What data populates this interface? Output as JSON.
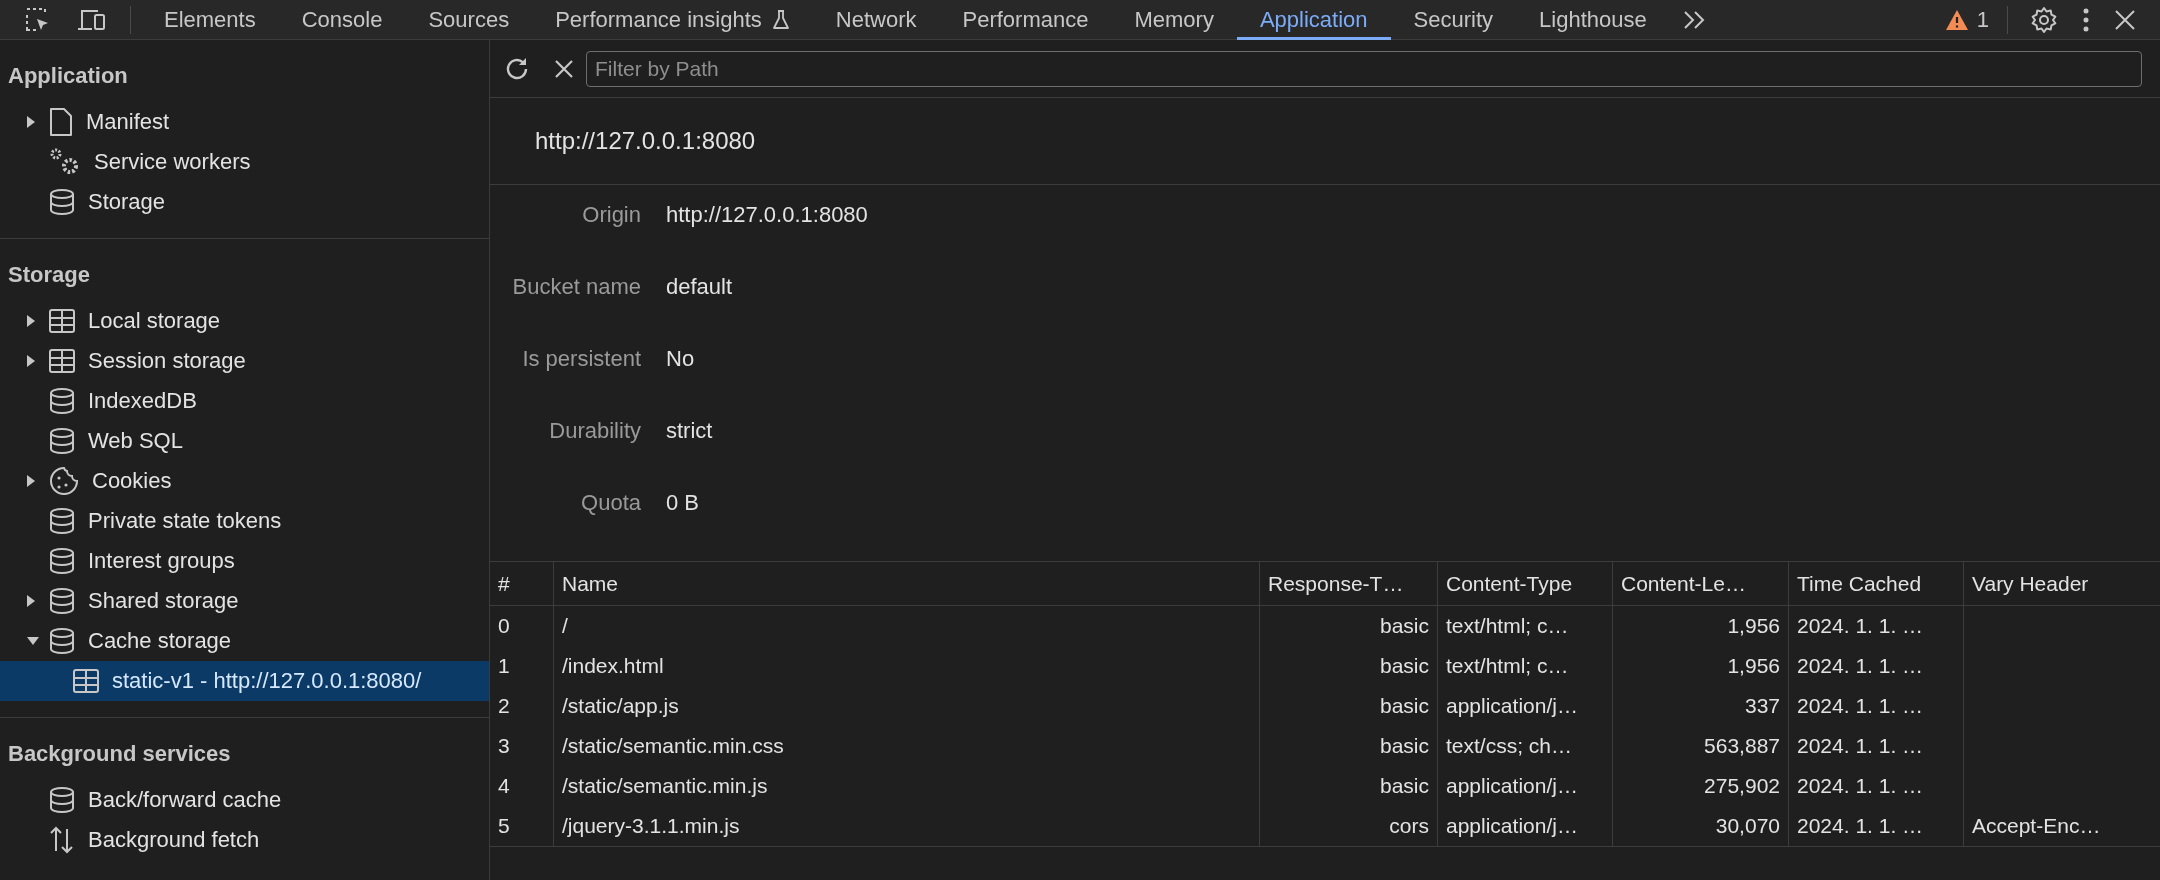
{
  "toolbar": {
    "tabs": [
      {
        "label": "Elements",
        "selected": false,
        "experimental": false
      },
      {
        "label": "Console",
        "selected": false,
        "experimental": false
      },
      {
        "label": "Sources",
        "selected": false,
        "experimental": false
      },
      {
        "label": "Performance insights",
        "selected": false,
        "experimental": true
      },
      {
        "label": "Network",
        "selected": false,
        "experimental": false
      },
      {
        "label": "Performance",
        "selected": false,
        "experimental": false
      },
      {
        "label": "Memory",
        "selected": false,
        "experimental": false
      },
      {
        "label": "Application",
        "selected": true,
        "experimental": false
      },
      {
        "label": "Security",
        "selected": false,
        "experimental": false
      },
      {
        "label": "Lighthouse",
        "selected": false,
        "experimental": false
      }
    ],
    "warning_count": "1"
  },
  "sidebar": {
    "sections": [
      {
        "title": "Application",
        "items": [
          {
            "label": "Manifest",
            "kind": "file",
            "expanded": false,
            "selected": false
          },
          {
            "label": "Service workers",
            "kind": "gears",
            "selected": false
          },
          {
            "label": "Storage",
            "kind": "database",
            "selected": false
          }
        ]
      },
      {
        "title": "Storage",
        "items": [
          {
            "label": "Local storage",
            "kind": "table",
            "expanded": false,
            "selected": false
          },
          {
            "label": "Session storage",
            "kind": "table",
            "expanded": false,
            "selected": false
          },
          {
            "label": "IndexedDB",
            "kind": "database",
            "selected": false
          },
          {
            "label": "Web SQL",
            "kind": "database",
            "selected": false
          },
          {
            "label": "Cookies",
            "kind": "cookie",
            "expanded": false,
            "selected": false
          },
          {
            "label": "Private state tokens",
            "kind": "database",
            "selected": false
          },
          {
            "label": "Interest groups",
            "kind": "database",
            "selected": false
          },
          {
            "label": "Shared storage",
            "kind": "database",
            "expanded": false,
            "selected": false
          },
          {
            "label": "Cache storage",
            "kind": "database",
            "expanded": true,
            "selected": false,
            "children": [
              {
                "label": "static-v1 - http://127.0.0.1:8080/",
                "kind": "table",
                "selected": true
              }
            ]
          }
        ]
      },
      {
        "title": "Background services",
        "items": [
          {
            "label": "Back/forward cache",
            "kind": "database",
            "selected": false
          },
          {
            "label": "Background fetch",
            "kind": "arrows",
            "selected": false
          }
        ]
      }
    ]
  },
  "filter": {
    "placeholder": "Filter by Path"
  },
  "origin_title": "http://127.0.0.1:8080",
  "details": [
    {
      "label": "Origin",
      "value": "http://127.0.0.1:8080"
    },
    {
      "label": "Bucket name",
      "value": "default"
    },
    {
      "label": "Is persistent",
      "value": "No"
    },
    {
      "label": "Durability",
      "value": "strict"
    },
    {
      "label": "Quota",
      "value": "0 B"
    }
  ],
  "table": {
    "columns": [
      {
        "label": "#",
        "kind": "text"
      },
      {
        "label": "Name",
        "kind": "text"
      },
      {
        "label": "Response-T…",
        "kind": "numeric"
      },
      {
        "label": "Content-Type",
        "kind": "text"
      },
      {
        "label": "Content-Le…",
        "kind": "numeric"
      },
      {
        "label": "Time Cached",
        "kind": "text"
      },
      {
        "label": "Vary Header",
        "kind": "text"
      }
    ],
    "rows": [
      [
        "0",
        "/",
        "basic",
        "text/html; c…",
        "1,956",
        "2024. 1. 1. …",
        ""
      ],
      [
        "1",
        "/index.html",
        "basic",
        "text/html; c…",
        "1,956",
        "2024. 1. 1. …",
        ""
      ],
      [
        "2",
        "/static/app.js",
        "basic",
        "application/j…",
        "337",
        "2024. 1. 1. …",
        ""
      ],
      [
        "3",
        "/static/semantic.min.css",
        "basic",
        "text/css; ch…",
        "563,887",
        "2024. 1. 1. …",
        ""
      ],
      [
        "4",
        "/static/semantic.min.js",
        "basic",
        "application/j…",
        "275,902",
        "2024. 1. 1. …",
        ""
      ],
      [
        "5",
        "/jquery-3.1.1.min.js",
        "cors",
        "application/j…",
        "30,070",
        "2024. 1. 1. …",
        "Accept-Enc…"
      ]
    ]
  }
}
